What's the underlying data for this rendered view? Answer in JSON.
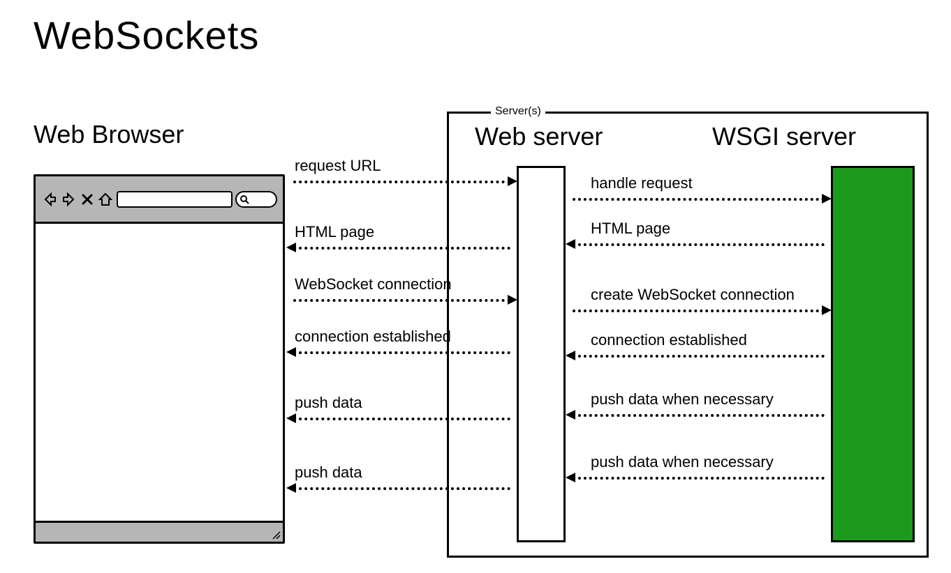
{
  "title": "WebSockets",
  "browser": {
    "label": "Web Browser"
  },
  "servers": {
    "legend": "Server(s)",
    "webserver_label": "Web server",
    "wsgi_label": "WSGI server"
  },
  "arrows_left": [
    {
      "label": "request URL",
      "dir": "right"
    },
    {
      "label": "HTML page",
      "dir": "left"
    },
    {
      "label": "WebSocket connection",
      "dir": "right"
    },
    {
      "label": "connection established",
      "dir": "left"
    },
    {
      "label": "push data",
      "dir": "left"
    },
    {
      "label": "push data",
      "dir": "left"
    }
  ],
  "arrows_right": [
    {
      "label": "handle request",
      "dir": "right"
    },
    {
      "label": "HTML page",
      "dir": "left"
    },
    {
      "label": "create WebSocket connection",
      "dir": "right"
    },
    {
      "label": "connection established",
      "dir": "left"
    },
    {
      "label": "push data when necessary",
      "dir": "left"
    },
    {
      "label": "push data when necessary",
      "dir": "left"
    }
  ],
  "colors": {
    "toolbar_bg": "#b6b6b6",
    "wsgi_bg": "#1c9a1c"
  }
}
